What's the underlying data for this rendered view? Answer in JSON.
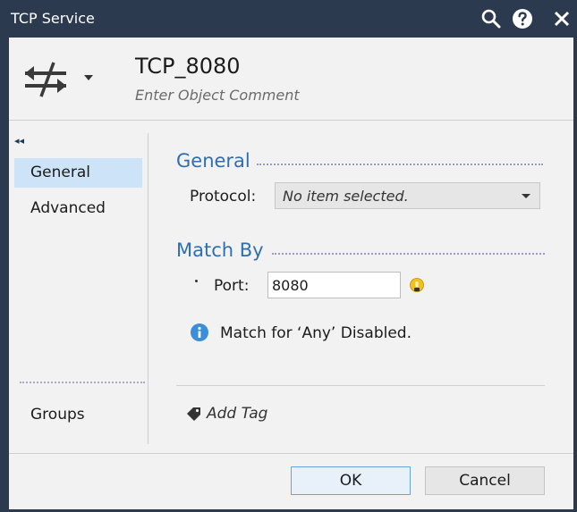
{
  "window": {
    "title": "TCP Service"
  },
  "header": {
    "object_name": "TCP_8080",
    "comment_placeholder": "Enter Object Comment"
  },
  "nav": {
    "items": [
      {
        "label": "General",
        "active": true
      },
      {
        "label": "Advanced",
        "active": false
      }
    ],
    "groups_label": "Groups"
  },
  "general": {
    "section_title": "General",
    "protocol_label": "Protocol:",
    "protocol_value": "No item selected."
  },
  "match_by": {
    "section_title": "Match By",
    "port_label": "Port:",
    "port_value": "8080",
    "info_text": "Match for ‘Any’ Disabled."
  },
  "tags": {
    "add_label": "Add Tag"
  },
  "footer": {
    "ok_label": "OK",
    "cancel_label": "Cancel"
  },
  "colors": {
    "title_bar": "#2b3a4f",
    "accent": "#2f6fb1",
    "nav_active": "#cde3f7",
    "bulb": "#f2c21b",
    "info": "#3a8fd8"
  }
}
